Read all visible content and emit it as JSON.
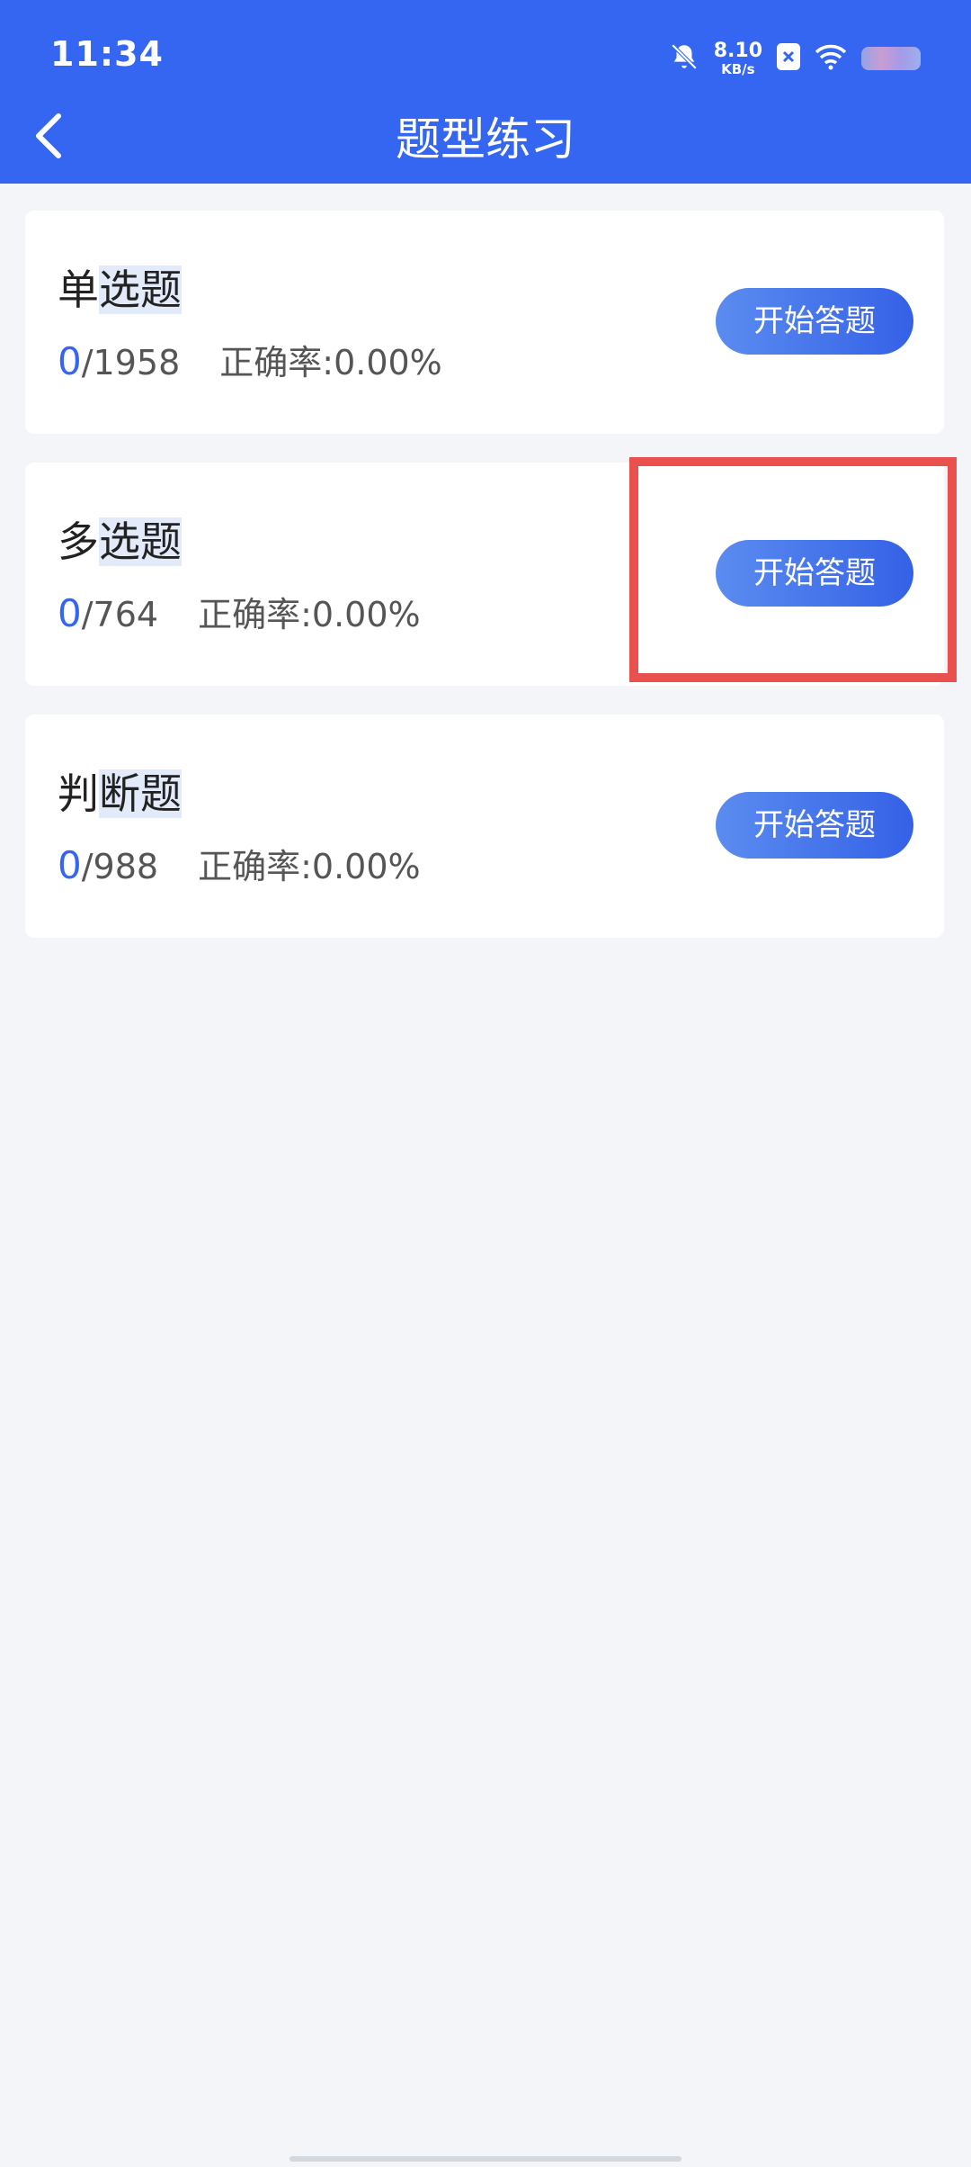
{
  "status_bar": {
    "time": "11:34",
    "net_speed_value": "8.10",
    "net_speed_unit": "KB/s",
    "icons": [
      "bell-off-icon",
      "close-badge-icon",
      "wifi-icon",
      "battery-icon"
    ]
  },
  "header": {
    "title": "题型练习",
    "back_icon": "chevron-left-icon"
  },
  "colors": {
    "accent": "#3466f1",
    "background": "#f3f5f9",
    "highlight_box": "#e8514d"
  },
  "cards": [
    {
      "title_prefix": "单",
      "title_rest": "选题",
      "done": "0",
      "total": "/1958",
      "accuracy_label": "正确率:",
      "accuracy_value": "0.00%",
      "button_label": "开始答题"
    },
    {
      "title_prefix": "多",
      "title_rest": "选题",
      "done": "0",
      "total": "/764",
      "accuracy_label": "正确率:",
      "accuracy_value": "0.00%",
      "button_label": "开始答题"
    },
    {
      "title_prefix": "判",
      "title_rest": "断题",
      "done": "0",
      "total": "/988",
      "accuracy_label": "正确率:",
      "accuracy_value": "0.00%",
      "button_label": "开始答题"
    }
  ]
}
